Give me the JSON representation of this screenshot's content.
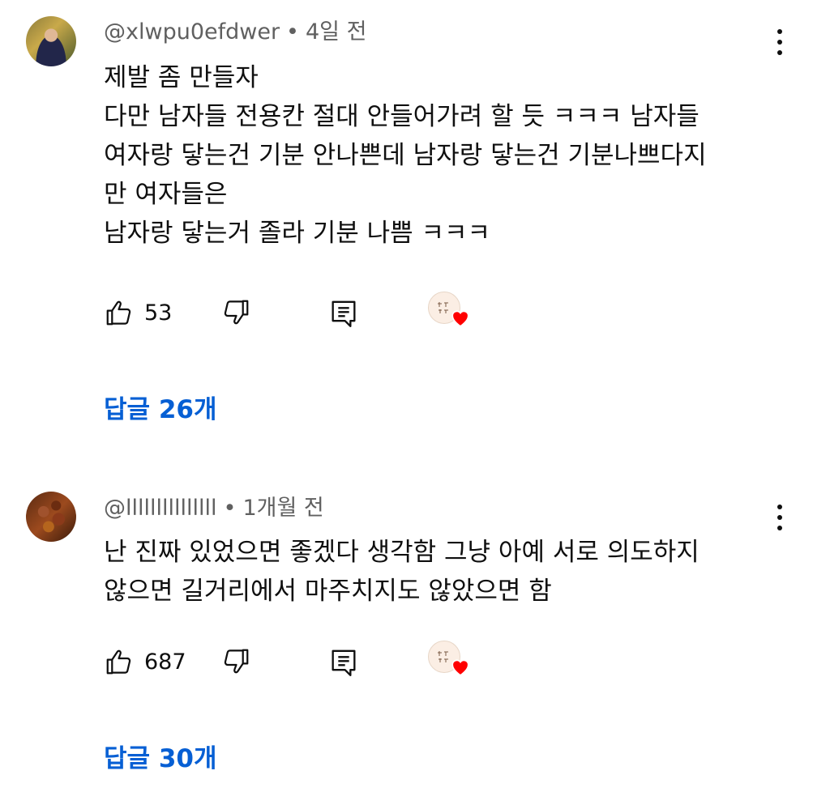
{
  "comments": [
    {
      "author": "@xlwpu0efdwer",
      "separator": "•",
      "time": "4일 전",
      "lines": [
        "제발 좀 만들자",
        "다만 남자들 전용칸 절대 안들어가려 할 듯 ㅋㅋㅋ 남자들",
        "여자랑 닿는건 기분 안나쁜데 남자랑 닿는건 기분나쁘다지",
        "만 여자들은",
        "남자랑 닿는거 졸라 기분 나쁨 ㅋㅋㅋ"
      ],
      "likes": "53",
      "replies_label": "답글 26개"
    },
    {
      "author": "@lllllllllllllll",
      "separator": "•",
      "time": "1개월 전",
      "lines": [
        "난 진짜 있었으면 좋겠다 생각함 그냥 아예 서로 의도하지",
        "않으면 길거리에서 마주치지도 않았으면 함"
      ],
      "likes": "687",
      "replies_label": "답글 30개"
    }
  ],
  "icons": {
    "like": "thumbs-up-icon",
    "dislike": "thumbs-down-icon",
    "reply": "reply-comment-icon",
    "more": "vertical-dots-icon",
    "heart": "creator-heart-icon"
  },
  "colors": {
    "reply_link": "#065fd4",
    "meta_text": "#606060",
    "heart": "#ff0000"
  }
}
